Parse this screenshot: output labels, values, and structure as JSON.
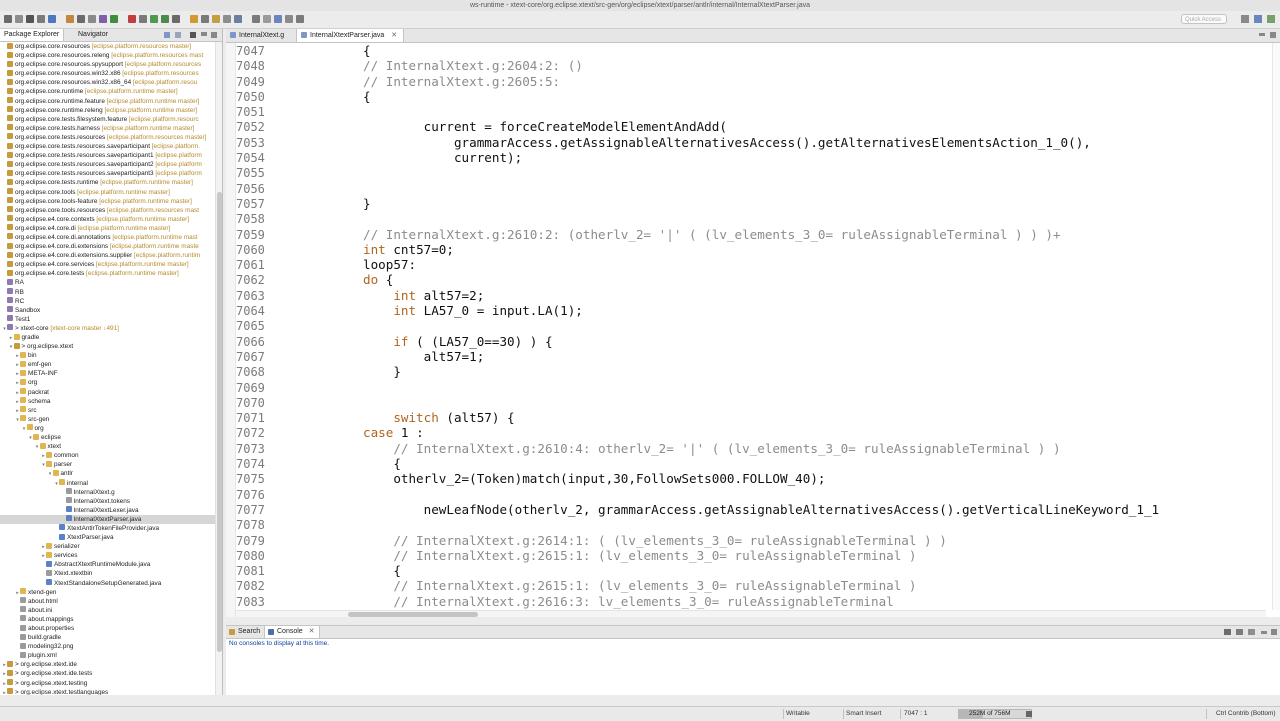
{
  "window": {
    "title": "ws-runtime - xtext-core/org.eclipse.xtext/src-gen/org/eclipse/xtext/parser/antlr/internal/InternalXtextParser.java"
  },
  "toolbar": {
    "quick_access_placeholder": "Quick Access"
  },
  "left_panel": {
    "tabs": [
      {
        "label": "Package Explorer"
      },
      {
        "label": "Navigator"
      }
    ],
    "tree": [
      {
        "indent": 0,
        "toggle": "",
        "icon": "package",
        "label": "org.eclipse.core.resources",
        "meta": " [eclipse.platform.resources master]"
      },
      {
        "indent": 0,
        "toggle": "",
        "icon": "package",
        "label": "org.eclipse.core.resources.releng",
        "meta": " [eclipse.platform.resources mast"
      },
      {
        "indent": 0,
        "toggle": "",
        "icon": "package",
        "label": "org.eclipse.core.resources.spysupport",
        "meta": " [eclipse.platform.resources"
      },
      {
        "indent": 0,
        "toggle": "",
        "icon": "package",
        "label": "org.eclipse.core.resources.win32.x86",
        "meta": " [eclipse.platform.resources"
      },
      {
        "indent": 0,
        "toggle": "",
        "icon": "package",
        "label": "org.eclipse.core.resources.win32.x86_64",
        "meta": " [eclipse.platform.resou"
      },
      {
        "indent": 0,
        "toggle": "",
        "icon": "package",
        "label": "org.eclipse.core.runtime",
        "meta": " [eclipse.platform.runtime master]"
      },
      {
        "indent": 0,
        "toggle": "",
        "icon": "package",
        "label": "org.eclipse.core.runtime.feature",
        "meta": " [eclipse.platform.runtime master]"
      },
      {
        "indent": 0,
        "toggle": "",
        "icon": "package",
        "label": "org.eclipse.core.runtime.releng",
        "meta": " [eclipse.platform.runtime master]"
      },
      {
        "indent": 0,
        "toggle": "",
        "icon": "package",
        "label": "org.eclipse.core.tests.filesystem.feature",
        "meta": " [eclipse.platform.resourc"
      },
      {
        "indent": 0,
        "toggle": "",
        "icon": "package",
        "label": "org.eclipse.core.tests.harness",
        "meta": " [eclipse.platform.runtime master]"
      },
      {
        "indent": 0,
        "toggle": "",
        "icon": "package",
        "label": "org.eclipse.core.tests.resources",
        "meta": " [eclipse.platform.resources master]"
      },
      {
        "indent": 0,
        "toggle": "",
        "icon": "package",
        "label": "org.eclipse.core.tests.resources.saveparticipant",
        "meta": " [eclipse.platform."
      },
      {
        "indent": 0,
        "toggle": "",
        "icon": "package",
        "label": "org.eclipse.core.tests.resources.saveparticipant1",
        "meta": " [eclipse.platform"
      },
      {
        "indent": 0,
        "toggle": "",
        "icon": "package",
        "label": "org.eclipse.core.tests.resources.saveparticipant2",
        "meta": " [eclipse.platform"
      },
      {
        "indent": 0,
        "toggle": "",
        "icon": "package",
        "label": "org.eclipse.core.tests.resources.saveparticipant3",
        "meta": " [eclipse.platform"
      },
      {
        "indent": 0,
        "toggle": "",
        "icon": "package",
        "label": "org.eclipse.core.tests.runtime",
        "meta": " [eclipse.platform.runtime master]"
      },
      {
        "indent": 0,
        "toggle": "",
        "icon": "package",
        "label": "org.eclipse.core.tools",
        "meta": " [eclipse.platform.runtime master]"
      },
      {
        "indent": 0,
        "toggle": "",
        "icon": "package",
        "label": "org.eclipse.core.tools-feature",
        "meta": " [eclipse.platform.runtime master]"
      },
      {
        "indent": 0,
        "toggle": "",
        "icon": "package",
        "label": "org.eclipse.core.tools.resources",
        "meta": " [eclipse.platform.resources mast"
      },
      {
        "indent": 0,
        "toggle": "",
        "icon": "package",
        "label": "org.eclipse.e4.core.contexts",
        "meta": " [eclipse.platform.runtime master]"
      },
      {
        "indent": 0,
        "toggle": "",
        "icon": "package",
        "label": "org.eclipse.e4.core.di",
        "meta": " [eclipse.platform.runtime master]"
      },
      {
        "indent": 0,
        "toggle": "",
        "icon": "package",
        "label": "org.eclipse.e4.core.di.annotations",
        "meta": " [eclipse.platform.runtime mast"
      },
      {
        "indent": 0,
        "toggle": "",
        "icon": "package",
        "label": "org.eclipse.e4.core.di.extensions",
        "meta": " [eclipse.platform.runtime maste"
      },
      {
        "indent": 0,
        "toggle": "",
        "icon": "package",
        "label": "org.eclipse.e4.core.di.extensions.supplier",
        "meta": " [eclipse.platform.runtim"
      },
      {
        "indent": 0,
        "toggle": "",
        "icon": "package",
        "label": "org.eclipse.e4.core.services",
        "meta": " [eclipse.platform.runtime master]"
      },
      {
        "indent": 0,
        "toggle": "",
        "icon": "package",
        "label": "org.eclipse.e4.core.tests",
        "meta": " [eclipse.platform.runtime master]"
      },
      {
        "indent": 0,
        "toggle": "",
        "icon": "project",
        "label": "RA",
        "meta": ""
      },
      {
        "indent": 0,
        "toggle": "",
        "icon": "project",
        "label": "RB",
        "meta": ""
      },
      {
        "indent": 0,
        "toggle": "",
        "icon": "project",
        "label": "RC",
        "meta": ""
      },
      {
        "indent": 0,
        "toggle": "",
        "icon": "project",
        "label": "Sandbox",
        "meta": ""
      },
      {
        "indent": 0,
        "toggle": "",
        "icon": "project",
        "label": "Test1",
        "meta": ""
      },
      {
        "indent": 0,
        "toggle": "▾",
        "icon": "project",
        "label": "> xtext-core",
        "meta": " [xtext-core master ↓491]"
      },
      {
        "indent": 1,
        "toggle": "▸",
        "icon": "folder",
        "label": "gradle",
        "meta": ""
      },
      {
        "indent": 1,
        "toggle": "▾",
        "icon": "package",
        "label": "> org.eclipse.xtext",
        "meta": ""
      },
      {
        "indent": 2,
        "toggle": "▸",
        "icon": "folder",
        "label": "bin",
        "meta": ""
      },
      {
        "indent": 2,
        "toggle": "▸",
        "icon": "folder",
        "label": "emf-gen",
        "meta": ""
      },
      {
        "indent": 2,
        "toggle": "▸",
        "icon": "folder",
        "label": "META-INF",
        "meta": ""
      },
      {
        "indent": 2,
        "toggle": "▸",
        "icon": "folder",
        "label": "org",
        "meta": ""
      },
      {
        "indent": 2,
        "toggle": "▸",
        "icon": "folder",
        "label": "packrat",
        "meta": ""
      },
      {
        "indent": 2,
        "toggle": "▸",
        "icon": "folder",
        "label": "schema",
        "meta": ""
      },
      {
        "indent": 2,
        "toggle": "▸",
        "icon": "folder",
        "label": "src",
        "meta": ""
      },
      {
        "indent": 2,
        "toggle": "▾",
        "icon": "folder",
        "label": "src-gen",
        "meta": ""
      },
      {
        "indent": 3,
        "toggle": "▾",
        "icon": "folder",
        "label": "org",
        "meta": ""
      },
      {
        "indent": 4,
        "toggle": "▾",
        "icon": "folder",
        "label": "eclipse",
        "meta": ""
      },
      {
        "indent": 5,
        "toggle": "▾",
        "icon": "folder",
        "label": "xtext",
        "meta": ""
      },
      {
        "indent": 6,
        "toggle": "▸",
        "icon": "folder",
        "label": "common",
        "meta": ""
      },
      {
        "indent": 6,
        "toggle": "▾",
        "icon": "folder",
        "label": "parser",
        "meta": ""
      },
      {
        "indent": 7,
        "toggle": "▾",
        "icon": "folder",
        "label": "antlr",
        "meta": ""
      },
      {
        "indent": 8,
        "toggle": "▾",
        "icon": "folder",
        "label": "internal",
        "meta": ""
      },
      {
        "indent": 9,
        "toggle": "",
        "icon": "file",
        "label": "InternalXtext.g",
        "meta": ""
      },
      {
        "indent": 9,
        "toggle": "",
        "icon": "file",
        "label": "InternalXtext.tokens",
        "meta": ""
      },
      {
        "indent": 9,
        "toggle": "",
        "icon": "java",
        "label": "InternalXtextLexer.java",
        "meta": ""
      },
      {
        "indent": 9,
        "toggle": "",
        "icon": "java",
        "label": "InternalXtextParser.java",
        "meta": "",
        "selected": true
      },
      {
        "indent": 8,
        "toggle": "",
        "icon": "java",
        "label": "XtextAntlrTokenFileProvider.java",
        "meta": ""
      },
      {
        "indent": 8,
        "toggle": "",
        "icon": "java",
        "label": "XtextParser.java",
        "meta": ""
      },
      {
        "indent": 6,
        "toggle": "▸",
        "icon": "folder",
        "label": "serializer",
        "meta": ""
      },
      {
        "indent": 6,
        "toggle": "▸",
        "icon": "folder",
        "label": "services",
        "meta": ""
      },
      {
        "indent": 6,
        "toggle": "",
        "icon": "java",
        "label": "AbstractXtextRuntimeModule.java",
        "meta": ""
      },
      {
        "indent": 6,
        "toggle": "",
        "icon": "file",
        "label": "Xtext.xtextbin",
        "meta": ""
      },
      {
        "indent": 6,
        "toggle": "",
        "icon": "java",
        "label": "XtextStandaloneSetupGenerated.java",
        "meta": ""
      },
      {
        "indent": 2,
        "toggle": "▸",
        "icon": "folder",
        "label": "xtend-gen",
        "meta": ""
      },
      {
        "indent": 2,
        "toggle": "",
        "icon": "file",
        "label": "about.html",
        "meta": ""
      },
      {
        "indent": 2,
        "toggle": "",
        "icon": "file",
        "label": "about.ini",
        "meta": ""
      },
      {
        "indent": 2,
        "toggle": "",
        "icon": "file",
        "label": "about.mappings",
        "meta": ""
      },
      {
        "indent": 2,
        "toggle": "",
        "icon": "file",
        "label": "about.properties",
        "meta": ""
      },
      {
        "indent": 2,
        "toggle": "",
        "icon": "file",
        "label": "build.gradle",
        "meta": ""
      },
      {
        "indent": 2,
        "toggle": "",
        "icon": "file",
        "label": "modeling32.png",
        "meta": ""
      },
      {
        "indent": 2,
        "toggle": "",
        "icon": "file",
        "label": "plugin.xml",
        "meta": ""
      },
      {
        "indent": 0,
        "toggle": "▸",
        "icon": "package",
        "label": "> org.eclipse.xtext.ide",
        "meta": ""
      },
      {
        "indent": 0,
        "toggle": "▸",
        "icon": "package",
        "label": "> org.eclipse.xtext.ide.tests",
        "meta": ""
      },
      {
        "indent": 0,
        "toggle": "▸",
        "icon": "package",
        "label": "> org.eclipse.xtext.testing",
        "meta": ""
      },
      {
        "indent": 0,
        "toggle": "▸",
        "icon": "package",
        "label": "> org.eclipse.xtext.testlanguages",
        "meta": ""
      }
    ]
  },
  "editor": {
    "tabs": [
      {
        "label": "InternalXtext.g"
      },
      {
        "label": "InternalXtextParser.java",
        "close": "✕"
      }
    ],
    "lines": [
      {
        "n": "7047",
        "s": [
          [
            "",
            "            {"
          ]
        ]
      },
      {
        "n": "7048",
        "s": [
          [
            "cm",
            "            // InternalXtext.g:2604:2: ()"
          ]
        ]
      },
      {
        "n": "7049",
        "s": [
          [
            "cm",
            "            // InternalXtext.g:2605:5:"
          ]
        ]
      },
      {
        "n": "7050",
        "s": [
          [
            "",
            "            {"
          ]
        ]
      },
      {
        "n": "7051",
        "s": [
          [
            "",
            ""
          ]
        ]
      },
      {
        "n": "7052",
        "s": [
          [
            "",
            "                    current = forceCreateModelElementAndAdd("
          ]
        ]
      },
      {
        "n": "7053",
        "s": [
          [
            "",
            "                        grammarAccess.getAssignableAlternativesAccess().getAlternativesElementsAction_1_0(),"
          ]
        ]
      },
      {
        "n": "7054",
        "s": [
          [
            "",
            "                        current);"
          ]
        ]
      },
      {
        "n": "7055",
        "s": [
          [
            "",
            ""
          ]
        ]
      },
      {
        "n": "7056",
        "s": [
          [
            "",
            ""
          ]
        ]
      },
      {
        "n": "7057",
        "s": [
          [
            "",
            "            }"
          ]
        ]
      },
      {
        "n": "7058",
        "s": [
          [
            "",
            ""
          ]
        ]
      },
      {
        "n": "7059",
        "s": [
          [
            "cm",
            "            // InternalXtext.g:2610:2: (otherlv_2= '|' ( (lv_elements_3_0= ruleAssignableTerminal ) ) )+"
          ]
        ]
      },
      {
        "n": "7060",
        "s": [
          [
            "kw",
            "            int"
          ],
          [
            "",
            " cnt57=0;"
          ]
        ]
      },
      {
        "n": "7061",
        "s": [
          [
            "",
            "            loop57:"
          ]
        ]
      },
      {
        "n": "7062",
        "s": [
          [
            "kw",
            "            do"
          ],
          [
            "",
            " {"
          ]
        ]
      },
      {
        "n": "7063",
        "s": [
          [
            "kw",
            "                int"
          ],
          [
            "",
            " alt57=2;"
          ]
        ]
      },
      {
        "n": "7064",
        "s": [
          [
            "kw",
            "                int"
          ],
          [
            "",
            " LA57_0 = input.LA(1);"
          ]
        ]
      },
      {
        "n": "7065",
        "s": [
          [
            "",
            ""
          ]
        ]
      },
      {
        "n": "7066",
        "s": [
          [
            "kw",
            "                if"
          ],
          [
            "",
            " ( (LA57_0==30) ) {"
          ]
        ]
      },
      {
        "n": "7067",
        "s": [
          [
            "",
            "                    alt57=1;"
          ]
        ]
      },
      {
        "n": "7068",
        "s": [
          [
            "",
            "                }"
          ]
        ]
      },
      {
        "n": "7069",
        "s": [
          [
            "",
            ""
          ]
        ]
      },
      {
        "n": "7070",
        "s": [
          [
            "",
            ""
          ]
        ]
      },
      {
        "n": "7071",
        "s": [
          [
            "kw",
            "                switch"
          ],
          [
            "",
            " (alt57) {"
          ]
        ]
      },
      {
        "n": "7072",
        "s": [
          [
            "kw",
            "            case"
          ],
          [
            "",
            " 1 :"
          ]
        ]
      },
      {
        "n": "7073",
        "s": [
          [
            "cm",
            "                // InternalXtext.g:2610:4: otherlv_2= '|' ( (lv_elements_3_0= ruleAssignableTerminal ) )"
          ]
        ]
      },
      {
        "n": "7074",
        "s": [
          [
            "",
            "                {"
          ]
        ]
      },
      {
        "n": "7075",
        "s": [
          [
            "",
            "                otherlv_2=(Token)match(input,30,FollowSets000.FOLLOW_40);"
          ]
        ]
      },
      {
        "n": "7076",
        "s": [
          [
            "",
            ""
          ]
        ]
      },
      {
        "n": "7077",
        "s": [
          [
            "",
            "                    newLeafNode(otherlv_2, grammarAccess.getAssignableAlternativesAccess().getVerticalLineKeyword_1_1"
          ]
        ]
      },
      {
        "n": "7078",
        "s": [
          [
            "",
            ""
          ]
        ]
      },
      {
        "n": "7079",
        "s": [
          [
            "cm",
            "                // InternalXtext.g:2614:1: ( (lv_elements_3_0= ruleAssignableTerminal ) )"
          ]
        ]
      },
      {
        "n": "7080",
        "s": [
          [
            "cm",
            "                // InternalXtext.g:2615:1: (lv_elements_3_0= ruleAssignableTerminal )"
          ]
        ]
      },
      {
        "n": "7081",
        "s": [
          [
            "",
            "                {"
          ]
        ]
      },
      {
        "n": "7082",
        "s": [
          [
            "cm",
            "                // InternalXtext.g:2615:1: (lv_elements_3_0= ruleAssignableTerminal )"
          ]
        ]
      },
      {
        "n": "7083",
        "s": [
          [
            "cm",
            "                // InternalXtext.g:2616:3: lv_elements_3_0= ruleAssignableTerminal"
          ]
        ]
      }
    ]
  },
  "console": {
    "tabs": [
      {
        "label": "Search"
      },
      {
        "label": "Console",
        "close": "✕"
      }
    ],
    "message": "No consoles to display at this time."
  },
  "status_bar": {
    "writable": "Writable",
    "insert_mode": "Smart Insert",
    "position": "7047 : 1",
    "heap": "252M of 756M",
    "heap_fraction": 0.33,
    "keybinding": "Ctrl Contrib (Bottom)"
  },
  "colors": {
    "keyword": "#b0651f",
    "comment": "#8c8c8c",
    "meta": "#b58a2c",
    "selection": "#d6d6d6"
  }
}
